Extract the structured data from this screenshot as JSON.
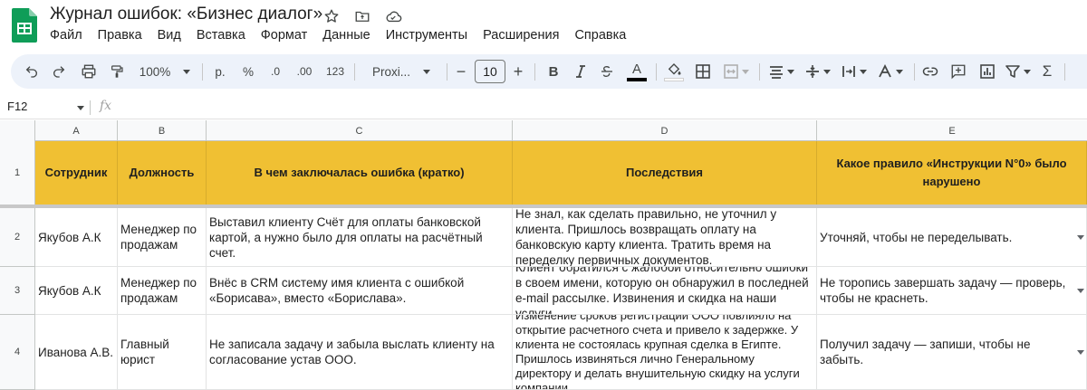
{
  "document": {
    "title": "Журнал ошибок: «Бизнес диалог»"
  },
  "menu": [
    "Файл",
    "Правка",
    "Вид",
    "Вставка",
    "Формат",
    "Данные",
    "Инструменты",
    "Расширения",
    "Справка"
  ],
  "toolbar": {
    "zoom": "100%",
    "currency": "р.",
    "percent": "%",
    "decrease_decimal": ".0",
    "increase_decimal": ".00",
    "number_format": "123",
    "font": "Proxi...",
    "font_size": "10",
    "minus": "−",
    "plus": "+",
    "bold": "B",
    "text_color": "A",
    "sum": "Σ"
  },
  "formula_bar": {
    "cell_ref": "F12",
    "fx": "fx",
    "formula": ""
  },
  "columns": [
    "A",
    "B",
    "C",
    "D",
    "E"
  ],
  "header_row": {
    "number": "1",
    "cells": [
      "Сотрудник",
      "Должность",
      "В чем заключалась ошибка (кратко)",
      "Последствия",
      "Какое правило «Инструкции N°0» было нарушено"
    ]
  },
  "rows": [
    {
      "number": "2",
      "cells": [
        "Якубов А.К",
        "Менеджер по продажам",
        "Выставил клиенту Счёт для оплаты банковской картой, а нужно было для оплаты на расчётный счет.",
        "Не знал, как сделать правильно, не уточнил у клиента. Пришлось возвращать оплату на банковскую карту клиента. Тратить время на переделку первичных документов.",
        "Уточняй, чтобы не переделывать."
      ]
    },
    {
      "number": "3",
      "cells": [
        "Якубов А.К",
        "Менеджер по продажам",
        "Внёс в CRM систему имя клиента с ошибкой «Борисава», вместо «Борислава».",
        "Клиент обратился с жалобой относительно ошибки в своем имени, которую он обнаружил в последней e-mail рассылке. Извинения и скидка на наши услуги.",
        "Не торопись завершать задачу — проверь, чтобы не краснеть."
      ]
    },
    {
      "number": "4",
      "cells": [
        "Иванова А.В.",
        "Главный юрист",
        "Не записала задачу и забыла выслать клиенту на согласование устав ООО.",
        "Изменение сроков регистрации ООО повлияло на открытие расчетного счета и привело к задержке. У клиента не состоялась крупная сделка в Египте. Пришлось извиняться лично Генеральному директору и делать внушительную скидку на услуги компании.",
        "Получил задачу — запиши, чтобы не забыть."
      ]
    }
  ],
  "colors": {
    "header_fill": "#f0c033",
    "toolbar_bg": "#edf2fa",
    "sheets_green": "#0f9d58"
  }
}
